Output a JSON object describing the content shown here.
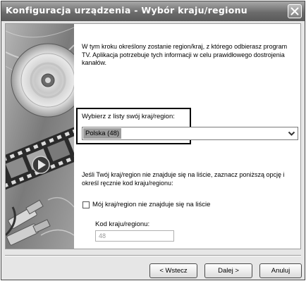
{
  "window": {
    "title": "Konfiguracja urządzenia - Wybór kraju/regionu",
    "close_glyph": "X"
  },
  "intro_text": "W tym kroku określony zostanie region/kraj, z którego odbierasz program TV. Aplikacja potrzebuje tych informacji w celu prawidłowego dostrojenia kanałów.",
  "country": {
    "label": "Wybierz z listy swój kraj/region:",
    "selected": "Polska (48)"
  },
  "manual_note": "Jeśli Twój kraj/region nie znajduje się na liście, zaznacz poniższą opcję i określ ręcznie kod kraju/regionu:",
  "not_listed_checkbox": {
    "label": "Mój kraj/region nie znajduje się na liście",
    "checked": false
  },
  "region_code": {
    "label": "Kod kraju/regionu:",
    "value": "48"
  },
  "buttons": {
    "back": "< Wstecz",
    "next": "Dalej >",
    "cancel": "Anuluj"
  },
  "icons": {
    "close": "close-icon",
    "dropdown": "chevron-down-icon",
    "sidebar": "cd-filmstrip-usb-illustration"
  }
}
